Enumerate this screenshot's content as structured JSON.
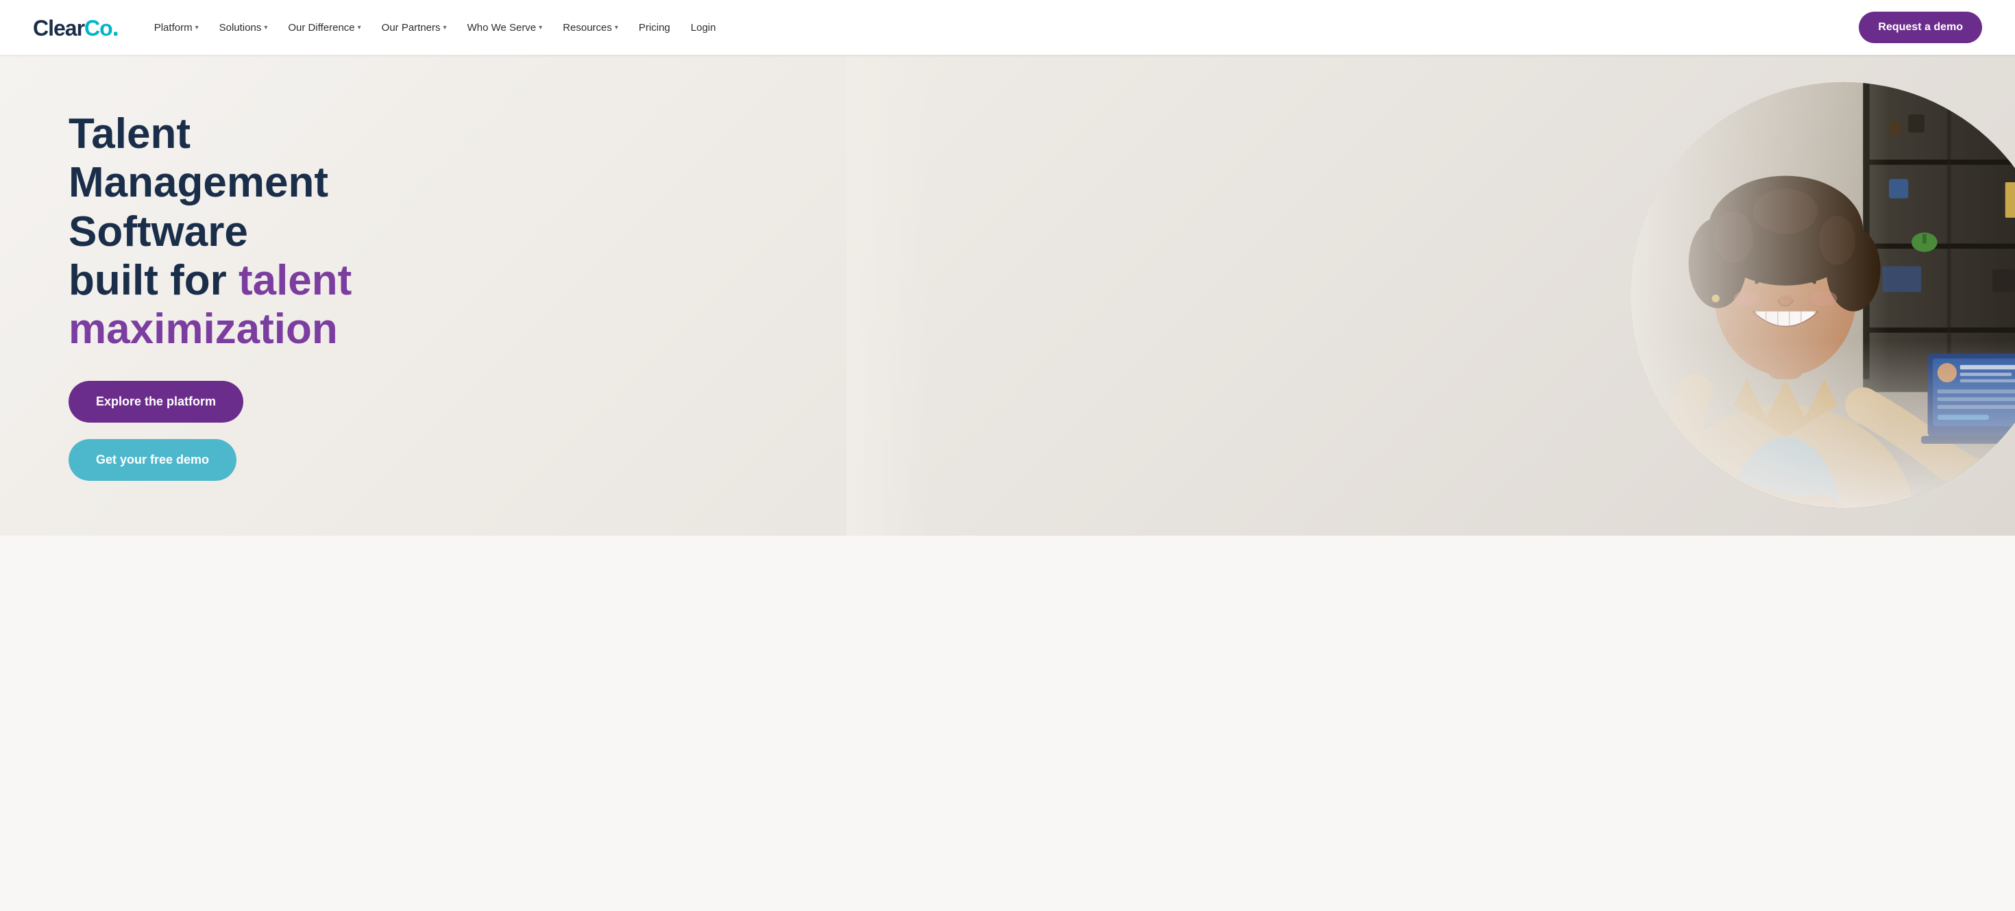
{
  "site": {
    "logo": {
      "text_clear": "Clear",
      "text_co": "Co",
      "dot": "."
    }
  },
  "header": {
    "nav_items": [
      {
        "label": "Platform",
        "has_dropdown": true
      },
      {
        "label": "Solutions",
        "has_dropdown": true
      },
      {
        "label": "Our Difference",
        "has_dropdown": true
      },
      {
        "label": "Our Partners",
        "has_dropdown": true
      },
      {
        "label": "Who We Serve",
        "has_dropdown": true
      },
      {
        "label": "Resources",
        "has_dropdown": true
      },
      {
        "label": "Pricing",
        "has_dropdown": false
      },
      {
        "label": "Login",
        "has_dropdown": false
      }
    ],
    "cta_button": "Request a demo"
  },
  "hero": {
    "title_line1": "Talent Management Software",
    "title_line2": "built for ",
    "title_highlight": "talent maximization",
    "button_explore": "Explore the platform",
    "button_demo": "Get your free demo"
  },
  "colors": {
    "purple_dark": "#6b2d8b",
    "teal": "#4db8cc",
    "navy": "#1a2e4a",
    "hero_bg": "#f0ece7"
  }
}
